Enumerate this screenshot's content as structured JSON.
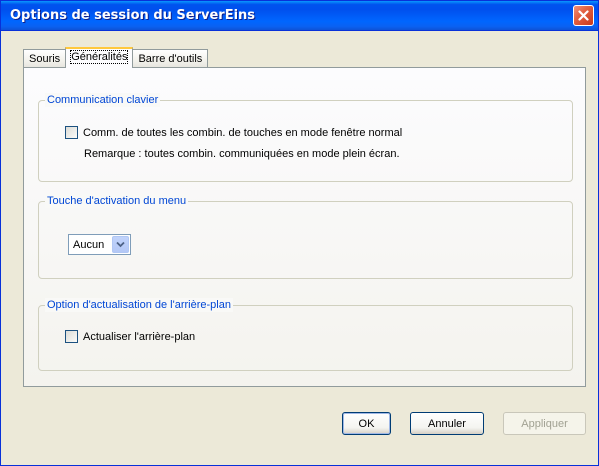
{
  "window": {
    "title": "Options de session du ServerEins"
  },
  "tabs": [
    {
      "label": "Souris",
      "active": false
    },
    {
      "label": "Généralités",
      "active": true
    },
    {
      "label": "Barre d'outils",
      "active": false
    }
  ],
  "groups": {
    "keyboard": {
      "legend": "Communication clavier",
      "checkbox_label": "Comm. de toutes les combin. de touches en mode fenêtre normal",
      "checked": false,
      "note": "Remarque : toutes combin. communiquées en mode plein écran."
    },
    "menu_key": {
      "legend": "Touche d'activation du menu",
      "selected": "Aucun"
    },
    "background": {
      "legend": "Option d'actualisation de l'arrière-plan",
      "checkbox_label": "Actualiser l'arrière-plan",
      "checked": false
    }
  },
  "buttons": {
    "ok": "OK",
    "cancel": "Annuler",
    "apply": "Appliquer"
  },
  "colors": {
    "titlebar": "#0054e3",
    "group_legend": "#0046d5",
    "window_bg": "#ece9d8",
    "close_button": "#e26142"
  }
}
